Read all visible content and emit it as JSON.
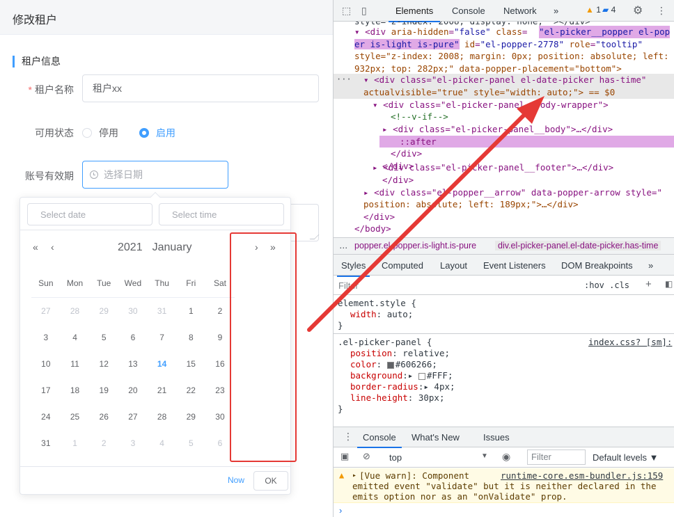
{
  "app": {
    "header_title": "修改租户",
    "section_title": "租户信息",
    "fields": {
      "tenant_name_label": "租户名称",
      "tenant_name_required": "*",
      "tenant_name_value": "租户xx",
      "status_label": "可用状态",
      "status_disabled": "停用",
      "status_enabled": "启用",
      "validity_label": "账号有效期",
      "validity_placeholder": "选择日期"
    },
    "datepicker": {
      "date_placeholder": "Select date",
      "time_placeholder": "Select time",
      "year": "2021",
      "month": "January",
      "prev_year": "«",
      "prev_month": "‹",
      "next_month": "›",
      "next_year": "»",
      "weekdays": [
        "Sun",
        "Mon",
        "Tue",
        "Wed",
        "Thu",
        "Fri",
        "Sat"
      ],
      "weeks": [
        [
          "27",
          "28",
          "29",
          "30",
          "31",
          "1",
          "2"
        ],
        [
          "3",
          "4",
          "5",
          "6",
          "7",
          "8",
          "9"
        ],
        [
          "10",
          "11",
          "12",
          "13",
          "14",
          "15",
          "16"
        ],
        [
          "17",
          "18",
          "19",
          "20",
          "21",
          "22",
          "23"
        ],
        [
          "24",
          "25",
          "26",
          "27",
          "28",
          "29",
          "30"
        ],
        [
          "31",
          "1",
          "2",
          "3",
          "4",
          "5",
          "6"
        ]
      ],
      "today": "14",
      "now_label": "Now",
      "ok_label": "OK"
    }
  },
  "devtools": {
    "tabs": [
      "Elements",
      "Console",
      "Network"
    ],
    "more": "»",
    "warn_count": "1",
    "info_count": "4",
    "dom": {
      "l0": "style=\"z-index: 2008; display: none;\" ></div>",
      "l1_open": "<div ",
      "l1_a1": "aria-hidden",
      "l1_v1": "\"false\"",
      "l1_a2": "class",
      "l1_v2": "\"el-picker__popper el-popper is-light is-pure\"",
      "l1_a3": "id",
      "l1_v3": "\"el-popper-2778\"",
      "l1_a4": "role",
      "l1_v4": "\"tooltip\"",
      "l2": "style=\"z-index: 2008; margin: 0px; position: absolute; left: 932px; top: 282px;\" data-popper-placement=\"bottom\">",
      "l3": "<div class=\"el-picker-panel el-date-picker has-time\"",
      "l4": "actualvisible=\"true\" style=\"width: auto;\"> == $0",
      "l5": "<div class=\"el-picker-panel__body-wrapper\">",
      "l6": "<!--v-if-->",
      "l7": "<div class=\"el-picker-panel__body\">…</div>",
      "l8": "::after",
      "l9": "</div>",
      "l10": "</div>",
      "l11": "<div class=\"el-picker-panel__footer\">…</div>",
      "l12": "</div>",
      "l13": "<div class=\"el-popper__arrow\" data-popper-arrow style=\"",
      "l14": "position: absolute; left: 189px;\">…</div>",
      "l15": "</div>",
      "l16": "</body>"
    },
    "breadcrumb": [
      "…",
      "popper.el-popper.is-light.is-pure",
      "div.el-picker-panel.el-date-picker.has-time"
    ],
    "styles_tabs": [
      "Styles",
      "Computed",
      "Layout",
      "Event Listeners",
      "DOM Breakpoints"
    ],
    "filter_placeholder": "Filter",
    "hov_cls": ":hov .cls",
    "css": {
      "element_style": "element.style {",
      "width_prop": "width",
      "width_val": "auto;",
      "close": "}",
      "rule_selector": ".el-picker-panel {",
      "rule_source": "index.css? [sm]:",
      "props": [
        {
          "name": "position",
          "value": "relative;"
        },
        {
          "name": "color",
          "value": "#606266;"
        },
        {
          "name": "background",
          "value": "#FFF;"
        },
        {
          "name": "border-radius",
          "value": "4px;"
        },
        {
          "name": "line-height",
          "value": "30px;"
        }
      ]
    },
    "drawer_tabs": [
      "Console",
      "What's New",
      "Issues"
    ],
    "console": {
      "context": "top",
      "filter_placeholder": "Filter",
      "levels": "Default levels ▼",
      "warn_line1": "[Vue warn]: Component",
      "warn_source": "runtime-core.esm-bundler.js:159",
      "warn_line2": "emitted event \"validate\" but it is neither declared in the",
      "warn_line3": "emits option nor as an \"onValidate\" prop.",
      "prompt": "›"
    }
  }
}
